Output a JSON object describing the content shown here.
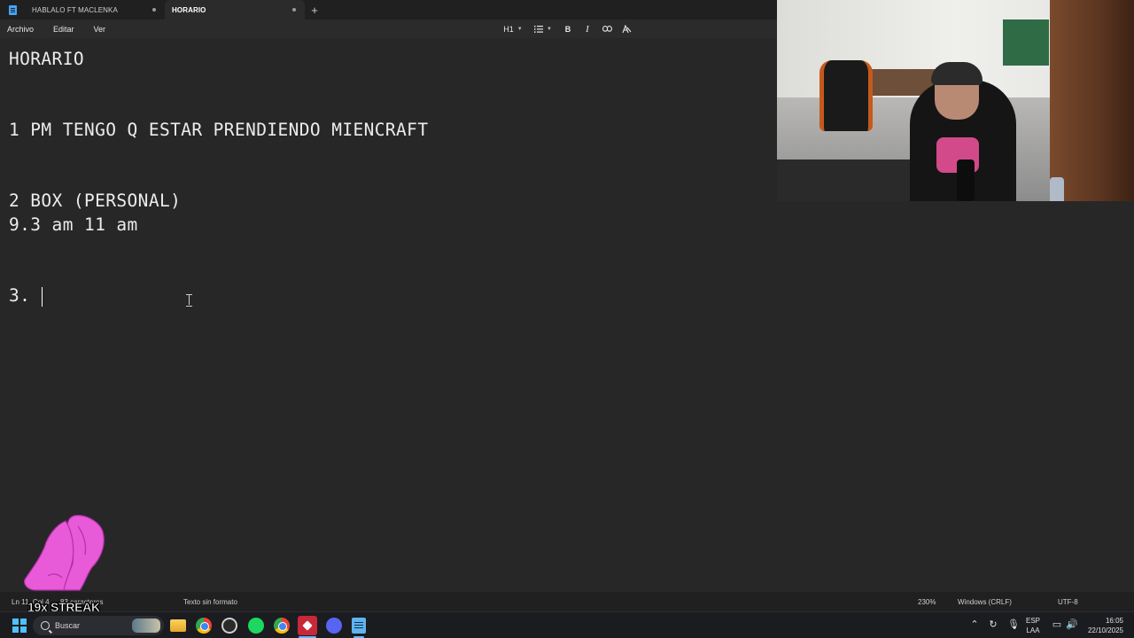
{
  "tabs": [
    {
      "label": "HABLALO FT MACLENKA"
    },
    {
      "label": "HORARIO"
    }
  ],
  "menu": [
    "Archivo",
    "Editar",
    "Ver"
  ],
  "toolbar": {
    "heading_label": "H1",
    "bold_label": "B",
    "italic_label": "I"
  },
  "document": {
    "lines": [
      "HORARIO",
      "1 PM TENGO Q ESTAR PRENDIENDO MIENCRAFT",
      "2 BOX (PERSONAL)",
      "9.3 am 11 am",
      "3."
    ]
  },
  "status": {
    "position": "Ln 11, Col 4",
    "chars": "83 caracteres",
    "format": "Texto sin formato",
    "zoom": "230%",
    "line_ending": "Windows (CRLF)",
    "encoding": "UTF-8"
  },
  "overlay": {
    "streak_text": "19x STREAK"
  },
  "taskbar": {
    "search_placeholder": "Buscar",
    "lang_line1": "ESP",
    "lang_line2": "LAA",
    "time": "16:05",
    "date": "22/10/2025"
  },
  "colors": {
    "editor_bg": "#272727",
    "accent": "#4cc2ff",
    "overlay_hands": "#e85ad8"
  }
}
